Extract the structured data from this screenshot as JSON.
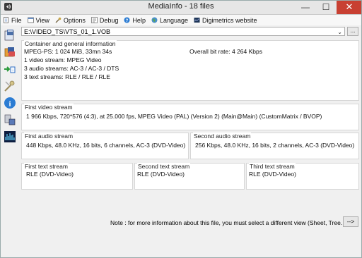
{
  "window": {
    "title": "MediaInfo - 18 files",
    "min": "—",
    "max": "☐",
    "close": "✕"
  },
  "menu": [
    "File",
    "View",
    "Options",
    "Debug",
    "Help",
    "Language",
    "Digimetrics website"
  ],
  "file_path": "E:\\VIDEO_TS\\VTS_01_1.VOB",
  "browse_label": "...",
  "general": {
    "title": "Container and general information",
    "lines": [
      "MPEG-PS: 1 024 MiB, 33mn 34s",
      "1 video stream: MPEG Video",
      "3 audio streams: AC-3 / AC-3 / DTS",
      "3 text streams: RLE / RLE / RLE"
    ],
    "bitrate": "Overall bit rate: 4 264 Kbps"
  },
  "video": {
    "title": "First video stream",
    "text": "1 966 Kbps, 720*576 (4:3), at 25.000 fps, MPEG Video (PAL) (Version 2) (Main@Main) (CustomMatrix / BVOP)"
  },
  "audio": [
    {
      "title": "First audio stream",
      "text": "448 Kbps, 48.0 KHz, 16 bits, 6 channels, AC-3 (DVD-Video)"
    },
    {
      "title": "Second audio stream",
      "text": "256 Kbps, 48.0 KHz, 16 bits, 2 channels, AC-3 (DVD-Video)"
    }
  ],
  "text_streams": [
    {
      "title": "First text stream",
      "text": "RLE (DVD-Video)"
    },
    {
      "title": "Second text stream",
      "text": "RLE (DVD-Video)"
    },
    {
      "title": "Third text stream",
      "text": "RLE (DVD-Video)"
    }
  ],
  "note": "Note : for more information about this file, you must select a different view (Sheet, Tree...)",
  "more_button": "-->"
}
